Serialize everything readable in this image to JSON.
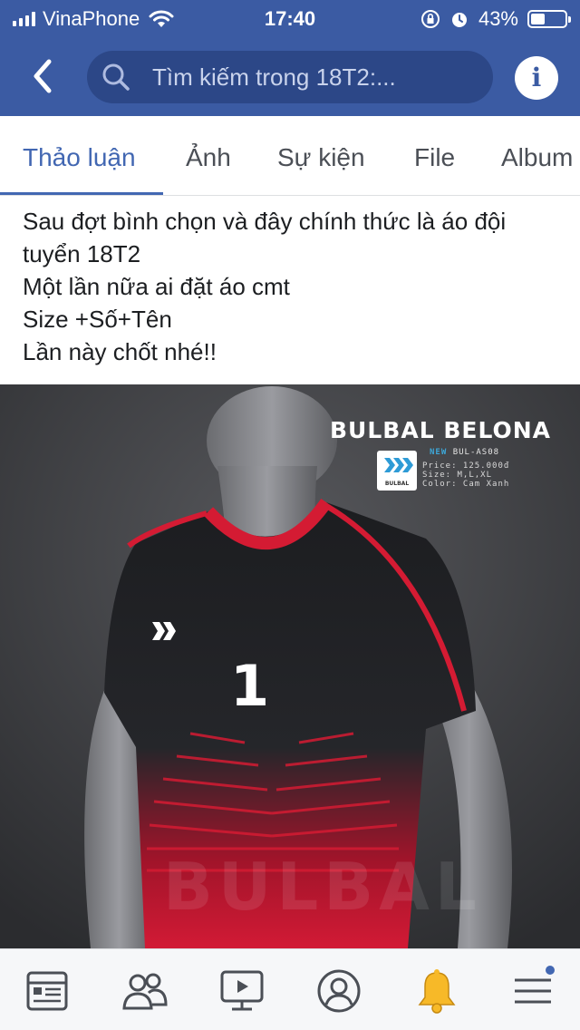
{
  "status_bar": {
    "carrier": "VinaPhone",
    "time": "17:40",
    "battery_percent": "43%",
    "battery_level": 0.43,
    "icons": [
      "signal-icon",
      "wifi-icon",
      "orientation-lock-icon",
      "alarm-icon",
      "battery-icon"
    ]
  },
  "header": {
    "back_icon": "chevron-left-icon",
    "search_placeholder": "Tìm kiếm trong 18T2:...",
    "info_label": "i"
  },
  "tabs": [
    {
      "label": "Thảo luận",
      "active": true
    },
    {
      "label": "Ảnh",
      "active": false
    },
    {
      "label": "Sự kiện",
      "active": false
    },
    {
      "label": "File",
      "active": false
    },
    {
      "label": "Album",
      "active": false
    }
  ],
  "post": {
    "lines": [
      "Sau đợt bình chọn và đây chính thức là áo đội",
      "tuyển 18T2",
      "Một lần nữa ai đặt áo cmt",
      "Size +Số+Tên",
      "Lần này chốt nhé!!"
    ]
  },
  "photo": {
    "brand": "BULBAL BELONA",
    "new_label": "NEW",
    "code": "BUL-AS08",
    "logo_text": "BULBAL",
    "specs": [
      "Price: 125.000đ",
      "Size: M,L,XL",
      "Color: Cam Xanh"
    ],
    "shirt_number": "1",
    "watermark": "BULBAL"
  },
  "bottom_nav": [
    {
      "name": "news-feed-icon"
    },
    {
      "name": "groups-icon"
    },
    {
      "name": "watch-video-icon"
    },
    {
      "name": "profile-icon"
    },
    {
      "name": "notifications-bell-icon"
    },
    {
      "name": "menu-icon",
      "badge": true
    }
  ],
  "colors": {
    "header_blue": "#3b5ba3",
    "search_bg": "#2c4787",
    "active_tab": "#4267b2",
    "bell_yellow": "#f7b928"
  }
}
